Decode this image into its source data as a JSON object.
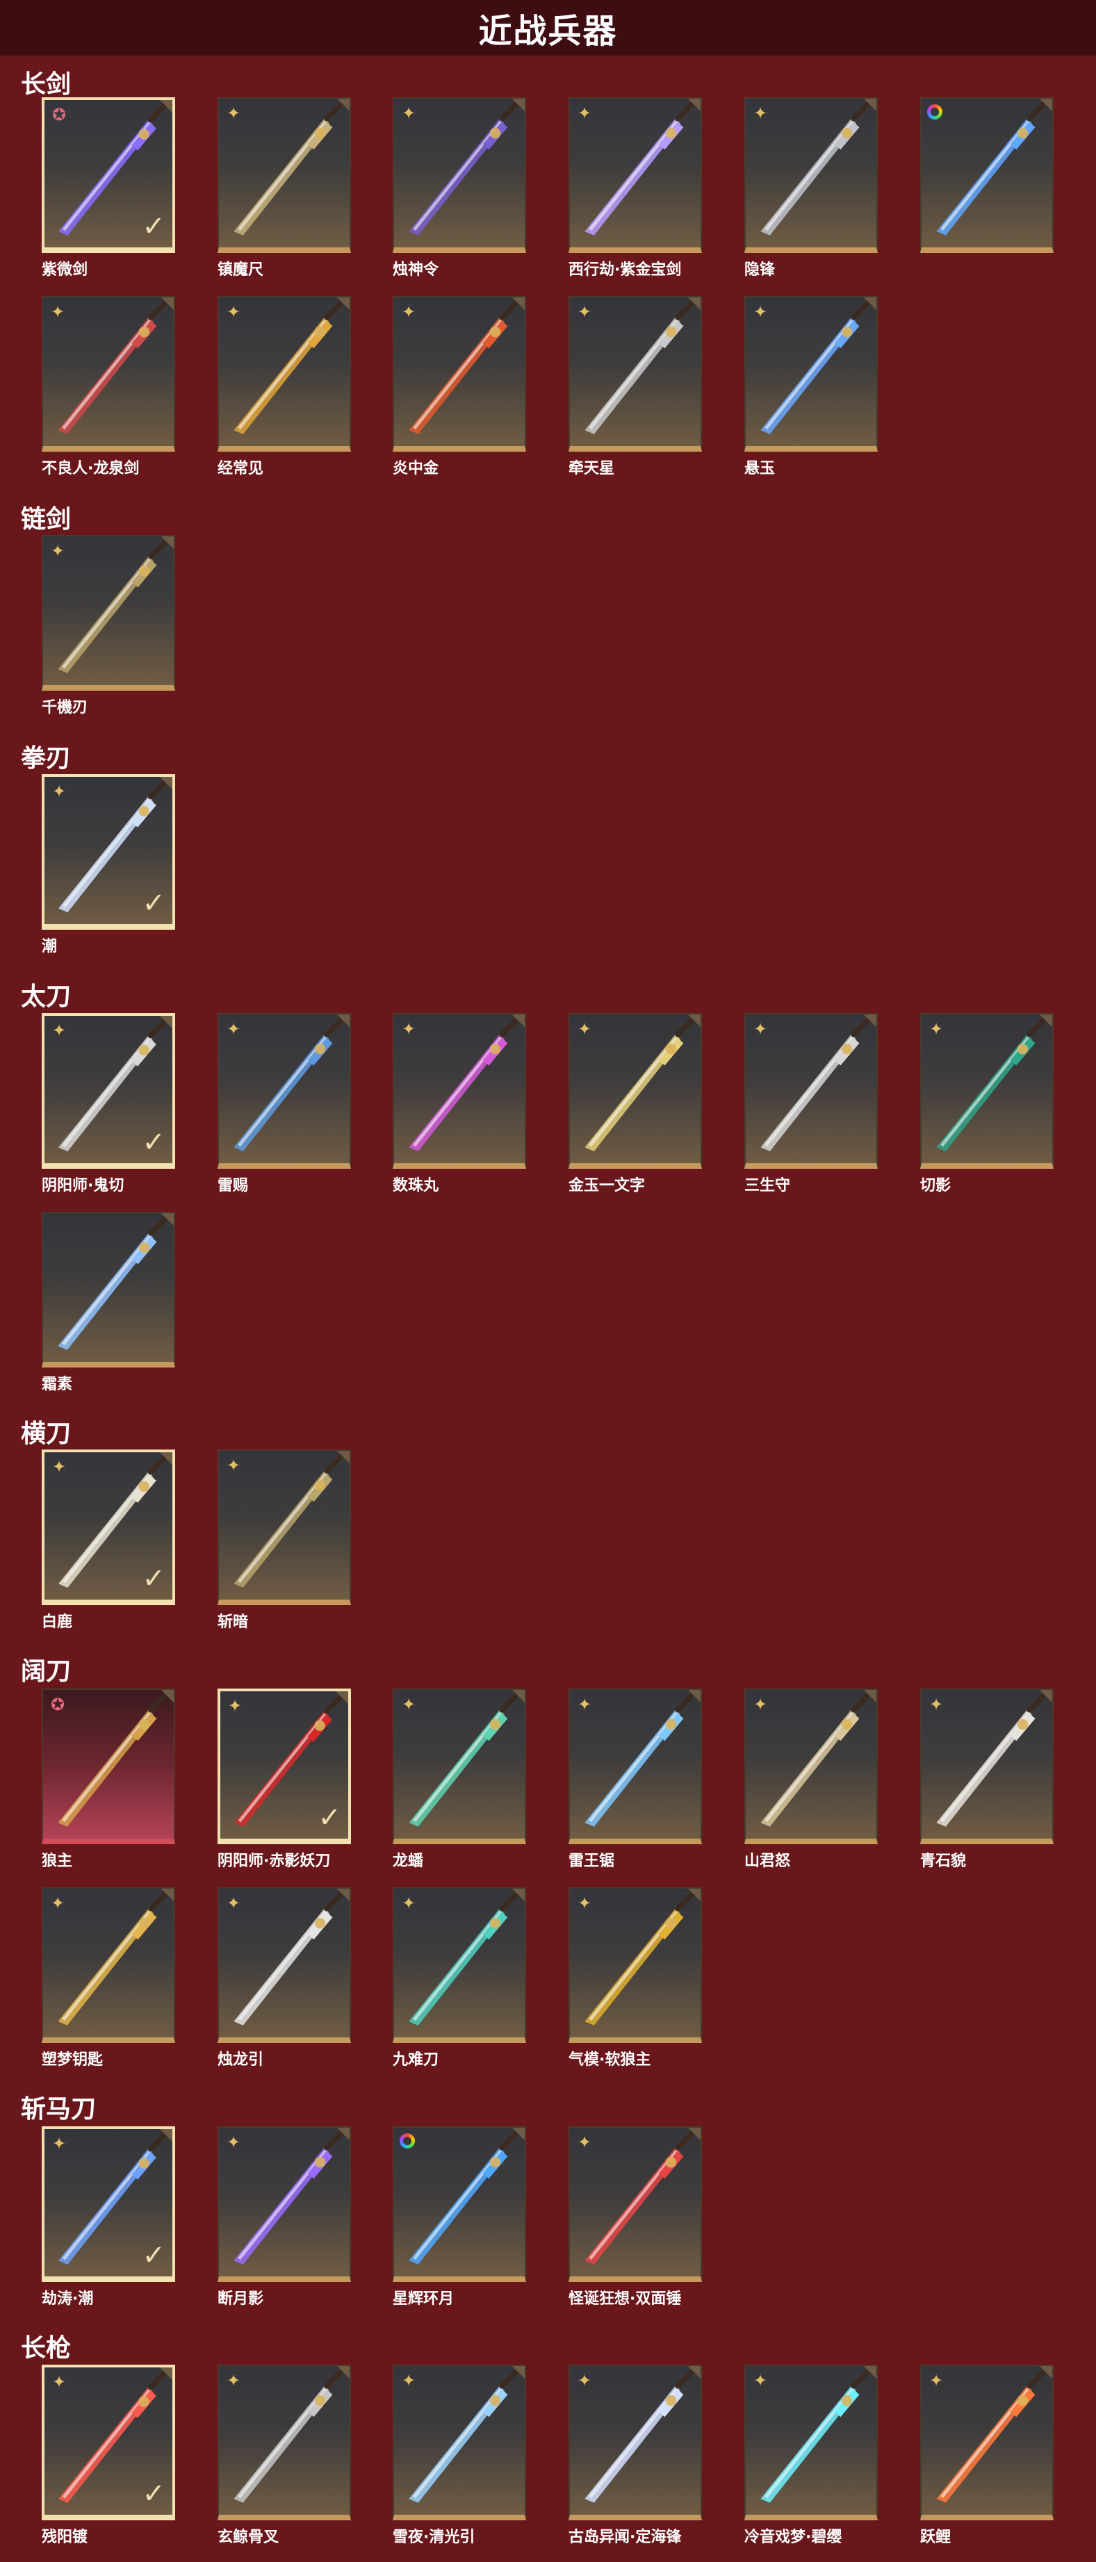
{
  "page_title": "近战兵器",
  "colors": {
    "background": "#6a171c",
    "header": "#3e0d12",
    "gold": "#c59a5c",
    "owned_border": "#f4e1b0"
  },
  "sections": [
    {
      "title": "长剑",
      "items": [
        {
          "name": "紫微剑",
          "badge": "star-icon",
          "owned": true,
          "color": "#8a6cff"
        },
        {
          "name": "镇魔尺",
          "badge": "shuriken-icon",
          "owned": false,
          "color": "#c8b27a"
        },
        {
          "name": "烛神令",
          "badge": "shuriken-icon",
          "owned": false,
          "color": "#7a5fd0"
        },
        {
          "name": "西行劫·紫金宝剑",
          "badge": "shuriken-icon",
          "owned": false,
          "color": "#b79cff"
        },
        {
          "name": "隐锋",
          "badge": "shuriken-icon",
          "owned": false,
          "color": "#c0c3cc"
        },
        {
          "name": "",
          "badge": "rainbow-ring-icon",
          "owned": false,
          "color": "#5fa7ff"
        },
        {
          "name": "不良人·龙泉剑",
          "badge": "shuriken-icon",
          "owned": false,
          "color": "#d04a4a"
        },
        {
          "name": "经常见",
          "badge": "shuriken-icon",
          "owned": false,
          "color": "#e2a53a"
        },
        {
          "name": "炎中金",
          "badge": "shuriken-icon",
          "owned": false,
          "color": "#e25a2d"
        },
        {
          "name": "牵天星",
          "badge": "shuriken-icon",
          "owned": false,
          "color": "#c9c9c9"
        },
        {
          "name": "悬玉",
          "badge": "shuriken-icon",
          "owned": false,
          "color": "#6aa8ff"
        }
      ]
    },
    {
      "title": "链剑",
      "items": [
        {
          "name": "千機刃",
          "badge": "shuriken-icon",
          "owned": false,
          "color": "#b9a36a"
        }
      ]
    },
    {
      "title": "拳刃",
      "items": [
        {
          "name": "潮",
          "badge": "shuriken-icon",
          "owned": true,
          "color": "#cfe0ff"
        }
      ]
    },
    {
      "title": "太刀",
      "items": [
        {
          "name": "阴阳师·鬼切",
          "badge": "shuriken-icon",
          "owned": true,
          "color": "#d8d8d8"
        },
        {
          "name": "雷赐",
          "badge": "shuriken-icon",
          "owned": false,
          "color": "#5d9ae0"
        },
        {
          "name": "数珠丸",
          "badge": "shuriken-icon",
          "owned": false,
          "color": "#d45ad8"
        },
        {
          "name": "金玉一文字",
          "badge": "shuriken-icon",
          "owned": false,
          "color": "#e4cf7a"
        },
        {
          "name": "三生守",
          "badge": "shuriken-icon",
          "owned": false,
          "color": "#d6d6d6"
        },
        {
          "name": "切影",
          "badge": "shuriken-icon",
          "owned": false,
          "color": "#2fa58a"
        },
        {
          "name": "霜素",
          "badge": "",
          "owned": false,
          "color": "#8fc1ff"
        }
      ]
    },
    {
      "title": "横刀",
      "items": [
        {
          "name": "白鹿",
          "badge": "shuriken-icon",
          "owned": true,
          "color": "#e8e1cf"
        },
        {
          "name": "斩暗",
          "badge": "shuriken-icon",
          "owned": false,
          "color": "#b8a56c"
        }
      ]
    },
    {
      "title": "阔刀",
      "items": [
        {
          "name": "狼主",
          "badge": "star-icon",
          "owned": false,
          "red": true,
          "color": "#d7a04a"
        },
        {
          "name": "阴阳师·赤影妖刀",
          "badge": "shuriken-icon",
          "owned": true,
          "color": "#d62a2a"
        },
        {
          "name": "龙蟠",
          "badge": "shuriken-icon",
          "owned": false,
          "color": "#5fd3b0"
        },
        {
          "name": "雷王锯",
          "badge": "shuriken-icon",
          "owned": false,
          "color": "#7fc8ff"
        },
        {
          "name": "山君怒",
          "badge": "shuriken-icon",
          "owned": false,
          "color": "#d8c79a"
        },
        {
          "name": "青石貌",
          "badge": "shuriken-icon",
          "owned": false,
          "color": "#e8e2da"
        },
        {
          "name": "塑梦钥匙",
          "badge": "shuriken-icon",
          "owned": false,
          "color": "#e3b54a"
        },
        {
          "name": "烛龙引",
          "badge": "shuriken-icon",
          "owned": false,
          "color": "#e4e4e4"
        },
        {
          "name": "九难刀",
          "badge": "shuriken-icon",
          "owned": false,
          "color": "#4fd0c0"
        },
        {
          "name": "气模·软狼主",
          "badge": "shuriken-icon",
          "owned": false,
          "color": "#e0b030"
        }
      ]
    },
    {
      "title": "斩马刀",
      "items": [
        {
          "name": "劫涛·潮",
          "badge": "shuriken-icon",
          "owned": true,
          "color": "#6ea2ff"
        },
        {
          "name": "断月影",
          "badge": "shuriken-icon",
          "owned": false,
          "color": "#9a6cff"
        },
        {
          "name": "星辉环月",
          "badge": "rainbow-ring-icon",
          "owned": false,
          "color": "#4fa8ff"
        },
        {
          "name": "怪诞狂想·双面锤",
          "badge": "shuriken-icon",
          "owned": false,
          "color": "#e64545"
        }
      ]
    },
    {
      "title": "长枪",
      "items": [
        {
          "name": "残阳镀",
          "badge": "shuriken-icon",
          "owned": true,
          "color": "#ff5a4f"
        },
        {
          "name": "玄鲸骨叉",
          "badge": "shuriken-icon",
          "owned": false,
          "color": "#c7c7c7"
        },
        {
          "name": "雪夜·清光引",
          "badge": "shuriken-icon",
          "owned": false,
          "color": "#9ad2ff"
        },
        {
          "name": "古岛异闻·定海锋",
          "badge": "shuriken-icon",
          "owned": false,
          "color": "#d3dfff"
        },
        {
          "name": "冷音戏梦·碧缨",
          "badge": "shuriken-icon",
          "owned": false,
          "color": "#6ff0ff"
        },
        {
          "name": "跃鲤",
          "badge": "shuriken-icon",
          "owned": false,
          "color": "#ff7a3a"
        }
      ]
    }
  ]
}
